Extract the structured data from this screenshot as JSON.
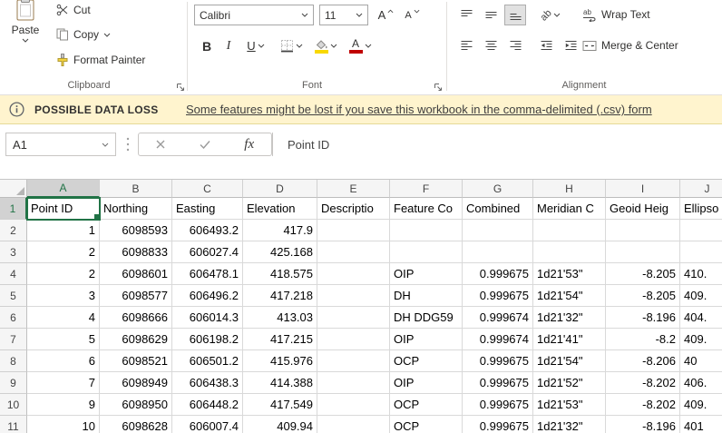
{
  "ribbon": {
    "clipboard": {
      "group_label": "Clipboard",
      "paste_label": "Paste",
      "cut_label": "Cut",
      "copy_label": "Copy",
      "format_painter_label": "Format Painter"
    },
    "font": {
      "group_label": "Font",
      "font_name": "Calibri",
      "font_size": "11",
      "bold_label": "B",
      "italic_label": "I",
      "underline_label": "U"
    },
    "alignment": {
      "group_label": "Alignment",
      "wrap_text_label": "Wrap Text",
      "merge_center_label": "Merge & Center",
      "orientation_glyph": "ab"
    }
  },
  "message_bar": {
    "title": "POSSIBLE DATA LOSS",
    "message": "Some features might be lost if you save this workbook in the comma-delimited (.csv) form"
  },
  "formula_bar": {
    "name_box": "A1",
    "fx_label": "fx",
    "content": "Point ID"
  },
  "sheet": {
    "selected_cell": "A1",
    "columns": [
      "A",
      "B",
      "C",
      "D",
      "E",
      "F",
      "G",
      "H",
      "I",
      "J"
    ],
    "rows": [
      {
        "n": "1",
        "cells": [
          "Point ID",
          "Northing",
          "Easting",
          "Elevation",
          "Descriptio",
          "Feature Co",
          "Combined",
          "Meridian C",
          "Geoid Heig",
          "Ellipso"
        ]
      },
      {
        "n": "2",
        "cells": [
          "1",
          "6098593",
          "606493.2",
          "417.9",
          "",
          "",
          "",
          "",
          "",
          ""
        ]
      },
      {
        "n": "3",
        "cells": [
          "2",
          "6098833",
          "606027.4",
          "425.168",
          "",
          "",
          "",
          "",
          "",
          ""
        ]
      },
      {
        "n": "4",
        "cells": [
          "2",
          "6098601",
          "606478.1",
          "418.575",
          "",
          "OIP",
          "0.999675",
          "1d21'53\"",
          "-8.205",
          "410."
        ]
      },
      {
        "n": "5",
        "cells": [
          "3",
          "6098577",
          "606496.2",
          "417.218",
          "",
          "DH",
          "0.999675",
          "1d21'54\"",
          "-8.205",
          "409."
        ]
      },
      {
        "n": "6",
        "cells": [
          "4",
          "6098666",
          "606014.3",
          "413.03",
          "",
          "DH DDG59",
          "0.999674",
          "1d21'32\"",
          "-8.196",
          "404."
        ]
      },
      {
        "n": "7",
        "cells": [
          "5",
          "6098629",
          "606198.2",
          "417.215",
          "",
          "OIP",
          "0.999674",
          "1d21'41\"",
          "-8.2",
          "409."
        ]
      },
      {
        "n": "8",
        "cells": [
          "6",
          "6098521",
          "606501.2",
          "415.976",
          "",
          "OCP",
          "0.999675",
          "1d21'54\"",
          "-8.206",
          "40"
        ]
      },
      {
        "n": "9",
        "cells": [
          "7",
          "6098949",
          "606438.3",
          "414.388",
          "",
          "OIP",
          "0.999675",
          "1d21'52\"",
          "-8.202",
          "406."
        ]
      },
      {
        "n": "10",
        "cells": [
          "9",
          "6098950",
          "606448.2",
          "417.549",
          "",
          "OCP",
          "0.999675",
          "1d21'53\"",
          "-8.202",
          "409."
        ]
      },
      {
        "n": "11",
        "cells": [
          "10",
          "6098628",
          "606007.4",
          "409.94",
          "",
          "OCP",
          "0.999675",
          "1d21'32\"",
          "-8.196",
          "401"
        ]
      }
    ]
  },
  "colors": {
    "accent_green": "#217346",
    "message_bar_bg": "#fff4ce",
    "fill_color_swatch": "#f8d800",
    "font_color_swatch": "#c00000"
  },
  "icons": {
    "clipboard-icon": "clipboard shape",
    "scissors-icon": "scissors shape",
    "copy-icon": "two overlapping pages",
    "paintbrush-icon": "brush",
    "chevron-down-icon": "small down triangle",
    "info-icon": "circled i",
    "cancel-icon": "x mark",
    "enter-icon": "check mark",
    "fx-icon": "italic fx",
    "select-all-icon": "corner triangle"
  }
}
